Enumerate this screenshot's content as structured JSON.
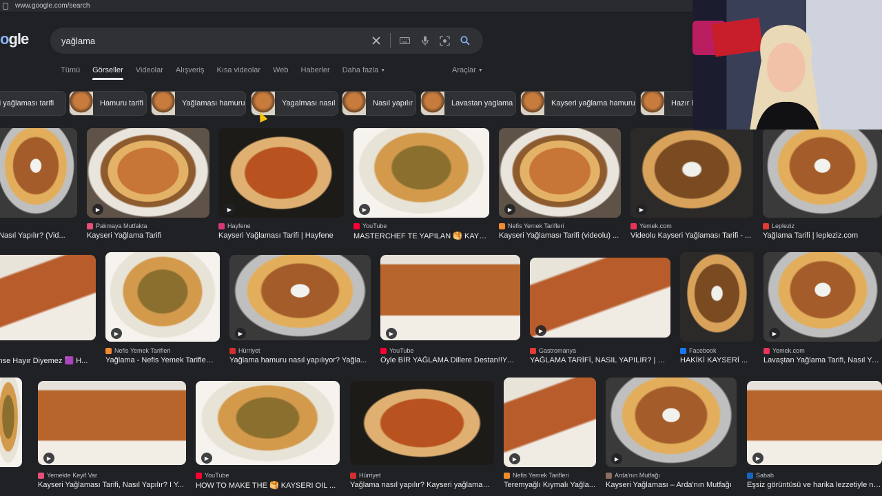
{
  "browser": {
    "url": "www.google.com/search"
  },
  "logo": {
    "text_left": "o",
    "text_right": "gle"
  },
  "search": {
    "value": "yağlama"
  },
  "tabs": [
    {
      "label": "Tümü",
      "active": false
    },
    {
      "label": "Görseller",
      "active": true
    },
    {
      "label": "Videolar",
      "active": false
    },
    {
      "label": "Alışveriş",
      "active": false
    },
    {
      "label": "Kısa videolar",
      "active": false
    },
    {
      "label": "Web",
      "active": false
    },
    {
      "label": "Haberler",
      "active": false
    },
    {
      "label": "Daha fazla",
      "active": false
    }
  ],
  "tools_label": "Araçlar",
  "chips": [
    "eri yağlaması tarifi",
    "Hamuru tarifi",
    "Yağlaması hamuru",
    "Yagalması nasıl",
    "Nasıl yapılır",
    "Lavastan yaglama",
    "Kayseri yağlama hamuru",
    "Hazır la"
  ],
  "results": {
    "row1": [
      {
        "source": "",
        "title": ", Nasıl Yapılır? (Vid...",
        "video": false
      },
      {
        "source": "Pakmaya Mutfakta",
        "title": "Kayseri Yağlama Tarifi",
        "video": true
      },
      {
        "source": "Hayfene",
        "title": "Kayseri Yağlaması Tarifi | Hayfene",
        "video": true
      },
      {
        "source": "YouTube",
        "title": "MASTERCHEF TE YAPILAN 🥞 KAYS...",
        "video": true
      },
      {
        "source": "Nefis Yemek Tarifleri",
        "title": "Kayseri Yağlaması Tarifi (videolu) ...",
        "video": true
      },
      {
        "source": "Yemek.com",
        "title": "Videolu Kayseri Yağlaması Tarifi - ...",
        "video": true
      },
      {
        "source": "Lepleziz",
        "title": "Yağlama Tarifi | lepleziz.com",
        "video": false
      }
    ],
    "row2": [
      {
        "source": "",
        "title": "imse Hayır Diyemez 🟪 H...",
        "video": false
      },
      {
        "source": "Nefis Yemek Tarifleri",
        "title": "Yağlama - Nefis Yemek Tarifleri ...",
        "video": true
      },
      {
        "source": "Hürriyet",
        "title": "Yağlama hamuru nasıl yapılıyor? Yağla...",
        "video": true
      },
      {
        "source": "YouTube",
        "title": "Öyle BİR YAĞLAMA Dillere Destan!!Yap...",
        "video": true
      },
      {
        "source": "Gastromanya",
        "title": "YAĞLAMA TARİFİ, NASIL YAPILIR? | K...",
        "video": true
      },
      {
        "source": "Facebook",
        "title": "HAKİKİ KAYSERİ ...",
        "video": false
      },
      {
        "source": "Yemek.com",
        "title": "Lavaştan Yağlama Tarifi, Nasıl Yapıl...",
        "video": true
      }
    ],
    "row3": [
      {
        "source": "",
        "title": "",
        "video": false
      },
      {
        "source": "Yemekte Keyif Var",
        "title": "Kayseri Yağlaması Tarifi, Nasıl Yapılır? I Y...",
        "video": true
      },
      {
        "source": "YouTube",
        "title": "HOW TO MAKE THE 🥞 KAYSERI OIL ...",
        "video": true
      },
      {
        "source": "Hürriyet",
        "title": "Yağlama nasıl yapılır? Kayseri yağlaması...",
        "video": false
      },
      {
        "source": "Nefis Yemek Tarifleri",
        "title": "Teremyağlı Kıymalı Yağla...",
        "video": true
      },
      {
        "source": "Arda'nın Mutfağı",
        "title": "Kayseri Yağlaması – Arda'nın Mutfağı",
        "video": true
      },
      {
        "source": "Sabah",
        "title": "Eşsiz görüntüsü ve harika lezzetiyle nefi...",
        "video": true
      }
    ]
  },
  "colors": {
    "background": "#202124",
    "searchbox": "#303134",
    "link_blue": "#8ab4f8"
  }
}
